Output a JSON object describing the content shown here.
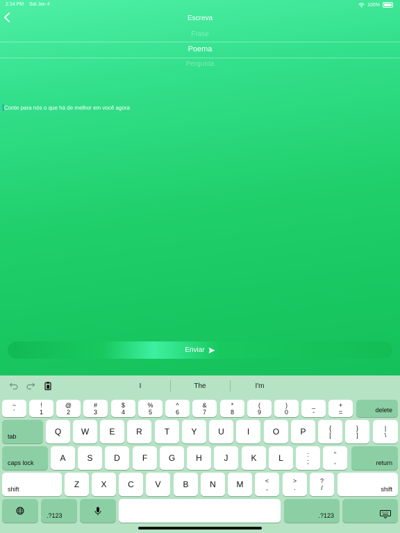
{
  "status_bar": {
    "time": "2:14 PM",
    "date": "Sat Jan 4",
    "battery": "100%"
  },
  "nav": {
    "title": "Escreva"
  },
  "picker": {
    "items": [
      "Frase",
      "Poema",
      "Pergunta"
    ]
  },
  "compose": {
    "placeholder": "Conte para nós o que há de melhor em você agora"
  },
  "send_button": {
    "label": "Enviar"
  },
  "keyboard": {
    "suggestions": [
      "I",
      "The",
      "I'm"
    ],
    "number_row": [
      {
        "top": "~",
        "bottom": "`"
      },
      {
        "top": "!",
        "bottom": "1"
      },
      {
        "top": "@",
        "bottom": "2"
      },
      {
        "top": "#",
        "bottom": "3"
      },
      {
        "top": "$",
        "bottom": "4"
      },
      {
        "top": "%",
        "bottom": "5"
      },
      {
        "top": "^",
        "bottom": "6"
      },
      {
        "top": "&",
        "bottom": "7"
      },
      {
        "top": "*",
        "bottom": "8"
      },
      {
        "top": "(",
        "bottom": "9"
      },
      {
        "top": ")",
        "bottom": "0"
      },
      {
        "top": "_",
        "bottom": "-"
      },
      {
        "top": "+",
        "bottom": "="
      }
    ],
    "delete": "delete",
    "tab": "tab",
    "row_q": [
      "Q",
      "W",
      "E",
      "R",
      "T",
      "Y",
      "U",
      "I",
      "O",
      "P"
    ],
    "row_q_symbols": [
      {
        "top": "{",
        "bottom": "["
      },
      {
        "top": "}",
        "bottom": "]"
      },
      {
        "top": "|",
        "bottom": "\\"
      }
    ],
    "caps_lock": "caps lock",
    "row_a": [
      "A",
      "S",
      "D",
      "F",
      "G",
      "H",
      "J",
      "K",
      "L"
    ],
    "row_a_symbols": [
      {
        "top": ":",
        "bottom": ";"
      },
      {
        "top": "\"",
        "bottom": ","
      }
    ],
    "return": "return",
    "shift": "shift",
    "row_z": [
      "Z",
      "X",
      "C",
      "V",
      "B",
      "N",
      "M"
    ],
    "row_z_symbols": [
      {
        "top": "<",
        "bottom": ","
      },
      {
        "top": ">",
        "bottom": "."
      },
      {
        "top": "?",
        "bottom": "/"
      }
    ],
    "numbers_key": ".?123"
  },
  "colors": {
    "accent": "#1fcf6a",
    "keyboard_bg": "#b5e3c4",
    "special_key": "#8ccfa4"
  }
}
